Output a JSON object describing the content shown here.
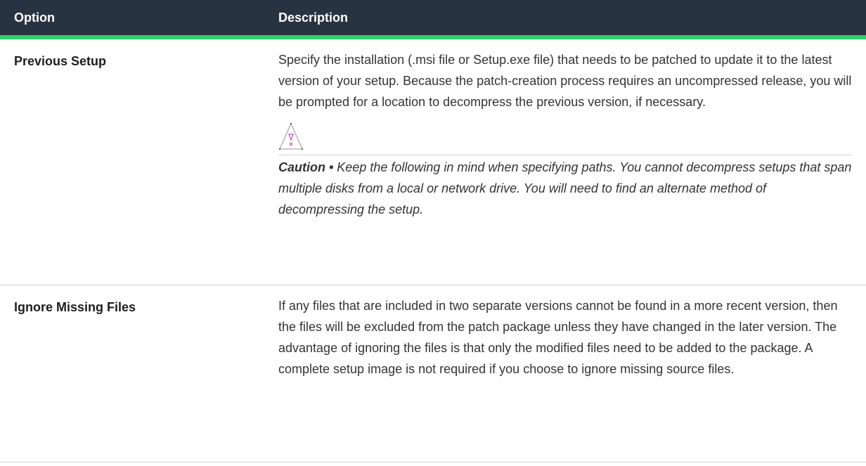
{
  "table": {
    "headers": {
      "option": "Option",
      "description": "Description"
    },
    "rows": [
      {
        "option": "Previous Setup",
        "description": "Specify the installation (.msi file or Setup.exe file) that needs to be patched to update it to the latest version of your setup. Because the patch-creation process requires an uncompressed release, you will be prompted for a location to decompress the previous version, if necessary.",
        "caution": {
          "icon": "caution-triangle-icon",
          "label": "Caution •",
          "text": " Keep the following in mind when specifying paths. You cannot decompress setups that span multiple disks from a local or network drive. You will need to find an alternate method of decompressing the setup."
        }
      },
      {
        "option": "Ignore Missing Files",
        "description": "If any files that are included in two separate versions cannot be found in a more recent version, then the files will be excluded from the patch package unless they have changed in the later version. The advantage of ignoring the files is that only the modified files need to be added to the package. A complete setup image is not required if you choose to ignore missing source files."
      }
    ]
  },
  "colors": {
    "header_bg": "#283342",
    "header_accent": "#2fd068",
    "caution_icon": "#b02bb0"
  }
}
